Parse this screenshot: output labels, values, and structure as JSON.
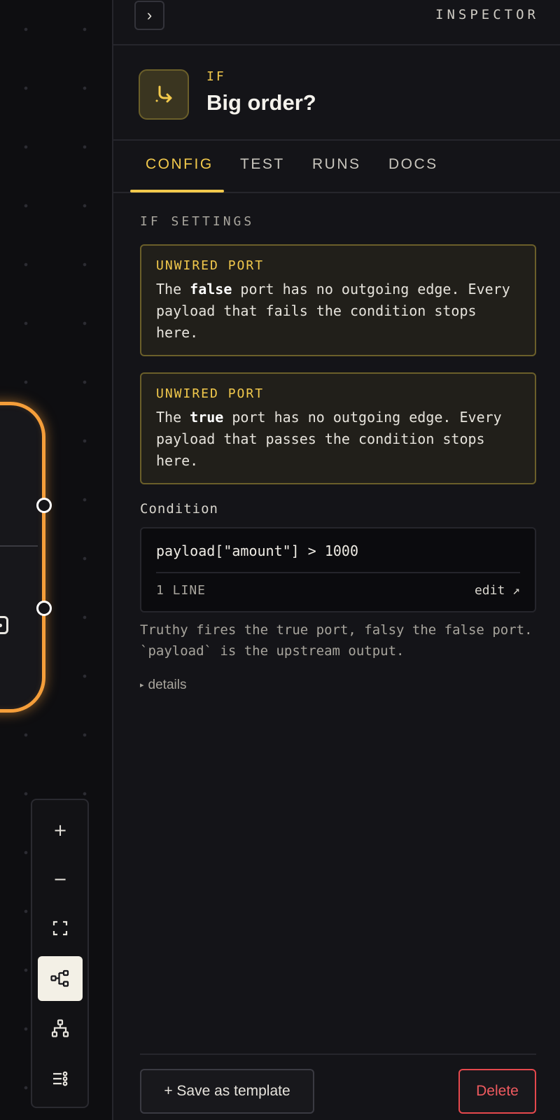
{
  "colors": {
    "accent": "#f2c94c",
    "node_border": "#f59e3a",
    "danger": "#e5484d",
    "panel_bg": "#141418",
    "canvas_bg": "#0e0e11"
  },
  "canvas": {
    "zoom_controls": [
      {
        "name": "zoom-in",
        "icon": "plus-icon",
        "glyph": "+"
      },
      {
        "name": "zoom-out",
        "icon": "minus-icon",
        "glyph": "−"
      },
      {
        "name": "fit-view",
        "icon": "fit-screen-icon"
      },
      {
        "name": "layout-horizontal",
        "icon": "flow-horizontal-icon",
        "active": true
      },
      {
        "name": "layout-vertical",
        "icon": "flow-vertical-icon"
      },
      {
        "name": "outline",
        "icon": "list-icon"
      }
    ]
  },
  "inspector": {
    "title": "INSPECTOR",
    "collapse_glyph": "›",
    "node": {
      "type_label": "IF",
      "icon": "branch-arrow-icon",
      "name": "Big order?"
    },
    "tabs": [
      {
        "label": "CONFIG",
        "active": true
      },
      {
        "label": "TEST"
      },
      {
        "label": "RUNS"
      },
      {
        "label": "DOCS"
      }
    ],
    "section_label": "IF SETTINGS",
    "warnings": [
      {
        "title": "UNWIRED PORT",
        "pre": "The ",
        "port": "false",
        "post": " port has no outgoing edge. Every payload that fails the condition stops here."
      },
      {
        "title": "UNWIRED PORT",
        "pre": "The ",
        "port": "true",
        "post": " port has no outgoing edge. Every payload that passes the condition stops here."
      }
    ],
    "condition": {
      "label": "Condition",
      "code": "payload[\"amount\"] > 1000",
      "line_count": "1 LINE",
      "edit_label": "edit ↗"
    },
    "hint": "Truthy fires the true port, falsy the false port. `payload` is the upstream output.",
    "details_caret": "▸",
    "details_label": "details",
    "footer": {
      "save_template_label": "+ Save as template",
      "delete_label": "Delete"
    }
  }
}
